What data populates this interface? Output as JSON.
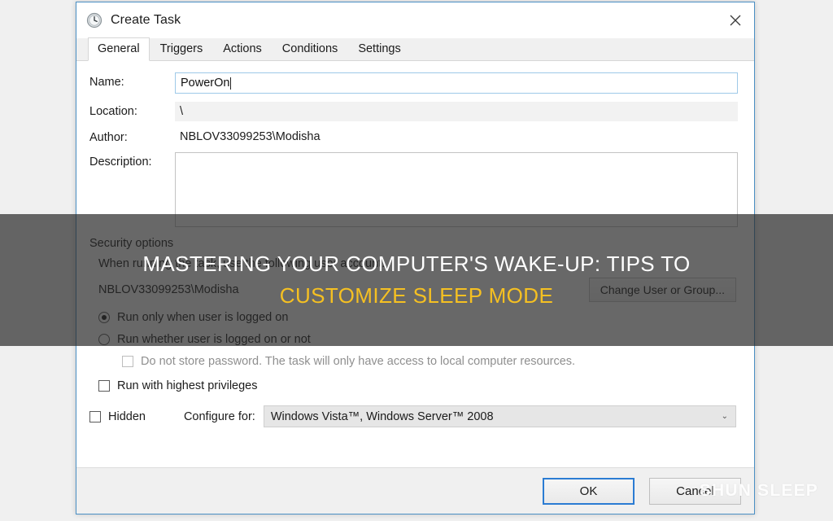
{
  "window": {
    "title": "Create Task",
    "icon": "clock-icon",
    "close_label": "✕"
  },
  "tabs": [
    {
      "label": "General",
      "active": true
    },
    {
      "label": "Triggers",
      "active": false
    },
    {
      "label": "Actions",
      "active": false
    },
    {
      "label": "Conditions",
      "active": false
    },
    {
      "label": "Settings",
      "active": false
    }
  ],
  "general": {
    "name_label": "Name:",
    "name_value": "PowerOn",
    "location_label": "Location:",
    "location_value": "\\",
    "author_label": "Author:",
    "author_value": "NBLOV33099253\\Modisha",
    "description_label": "Description:",
    "description_value": ""
  },
  "security": {
    "section_title": "Security options",
    "account_prompt": "When running the task, use the following user account:",
    "account_name": "NBLOV33099253\\Modisha",
    "change_user_button": "Change User or Group...",
    "run_logged_on_label": "Run only when user is logged on",
    "run_logged_on_checked": true,
    "run_whether_label": "Run whether user is logged on or not",
    "run_whether_checked": false,
    "no_store_password_label": "Do not store password.  The task will only have access to local computer resources.",
    "no_store_password_checked": false,
    "highest_privileges_label": "Run with highest privileges",
    "highest_privileges_checked": false
  },
  "bottom": {
    "hidden_label": "Hidden",
    "hidden_checked": false,
    "configure_for_label": "Configure for:",
    "configure_for_value": "Windows Vista™, Windows Server™ 2008",
    "chevron": "⌄"
  },
  "footer": {
    "ok_label": "OK",
    "cancel_label": "Cancel"
  },
  "overlay": {
    "line1": "MASTERING YOUR COMPUTER'S WAKE-UP: TIPS TO",
    "line2": "CUSTOMIZE SLEEP MODE",
    "line1_color": "#ffffff",
    "line2_color": "#f5c022",
    "band_color": "rgba(40,40,40,0.70)"
  },
  "watermark": {
    "text": "SHUN SLEEP"
  }
}
